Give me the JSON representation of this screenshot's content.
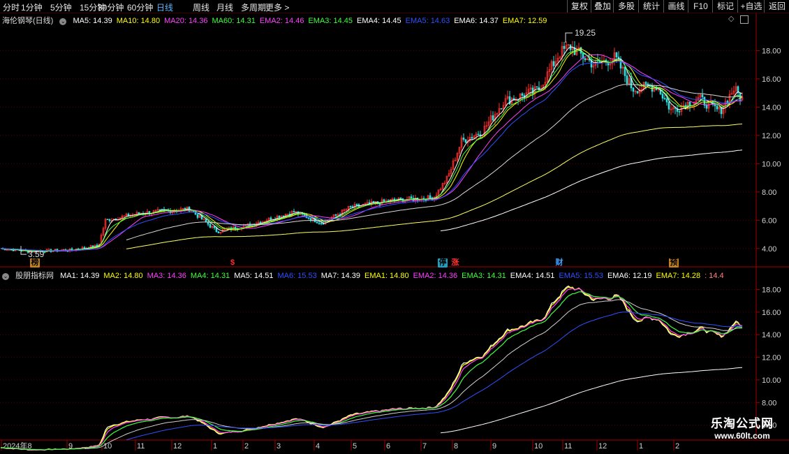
{
  "toolbar": {
    "periods": [
      "分时",
      "1分钟",
      "5分钟",
      "15分钟",
      "30分钟",
      "60分钟",
      "日线",
      "周线",
      "月线",
      "多周期",
      "更多 >"
    ],
    "active_index": 6,
    "right_buttons": [
      "复权",
      "叠加",
      "多股",
      "统计",
      "画线",
      "F10",
      "标记",
      "+自选",
      "返回"
    ]
  },
  "main_panel": {
    "title": "海伦钢琴(日线)",
    "indicators": [
      {
        "label": "MA5: 14.39",
        "color": "#ffffff"
      },
      {
        "label": "MA10: 14.80",
        "color": "#ffff00"
      },
      {
        "label": "MA20: 14.36",
        "color": "#ff40ff"
      },
      {
        "label": "MA60: 14.31",
        "color": "#40ff40"
      },
      {
        "label": "EMA2: 14.46",
        "color": "#ff40ff"
      },
      {
        "label": "EMA3: 14.45",
        "color": "#40ff40"
      },
      {
        "label": "EMA4: 14.45",
        "color": "#ffffff"
      },
      {
        "label": "EMA5: 14.63",
        "color": "#3050ff"
      },
      {
        "label": "EMA6: 14.37",
        "color": "#ffffff"
      },
      {
        "label": "EMA7: 12.59",
        "color": "#ffff00"
      }
    ],
    "y_ticks": [
      "18.00",
      "16.00",
      "14.00",
      "12.00",
      "10.00",
      "8.00",
      "6.00",
      "4.00"
    ],
    "high_label": "19.25",
    "low_label": "3.59",
    "markers": [
      {
        "text": "榜",
        "bg": "#c08020",
        "fg": "#000"
      },
      {
        "text": "$",
        "bg": "transparent",
        "fg": "#ff3030"
      },
      {
        "text": "停",
        "bg": "#20a0c0",
        "fg": "#000"
      },
      {
        "text": "涨",
        "bg": "transparent",
        "fg": "#ff3030"
      },
      {
        "text": "财",
        "bg": "transparent",
        "fg": "#40a0ff"
      },
      {
        "text": "预",
        "bg": "#c08020",
        "fg": "#000"
      }
    ]
  },
  "sub_panel": {
    "title": "股朋指标网",
    "indicators": [
      {
        "label": "MA1: 14.39",
        "color": "#ffffff"
      },
      {
        "label": "MA2: 14.80",
        "color": "#ffff00"
      },
      {
        "label": "MA3: 14.36",
        "color": "#ff40ff"
      },
      {
        "label": "MA4: 14.31",
        "color": "#40ff40"
      },
      {
        "label": "MA5: 14.51",
        "color": "#ffffff"
      },
      {
        "label": "MA6: 15.53",
        "color": "#3050ff"
      },
      {
        "label": "MA7: 14.39",
        "color": "#ffffff"
      },
      {
        "label": "EMA1: 14.80",
        "color": "#ffff00"
      },
      {
        "label": "EMA2: 14.36",
        "color": "#ff40ff"
      },
      {
        "label": "EMA3: 14.31",
        "color": "#40ff40"
      },
      {
        "label": "EMA4: 14.51",
        "color": "#ffffff"
      },
      {
        "label": "EMA5: 15.53",
        "color": "#3050ff"
      },
      {
        "label": "EMA6: 12.19",
        "color": "#ffffff"
      },
      {
        "label": "EMA7: 14.28",
        "color": "#ffff00"
      },
      {
        "label": ": 14.4",
        "color": "#ff8080"
      }
    ],
    "y_ticks": [
      "18.00",
      "16.00",
      "14.00",
      "12.00",
      "10.00",
      "8.00",
      "6.00"
    ]
  },
  "x_axis": [
    "2024年8",
    "9",
    "10",
    "11",
    "12",
    "1",
    "2",
    "3",
    "4",
    "5",
    "6",
    "7",
    "8",
    "9",
    "10",
    "11",
    "12",
    "1",
    "2"
  ],
  "colors": {
    "up": "#ff3030",
    "down": "#30e0e0",
    "grid": "#5a0000",
    "axis": "#a00000",
    "tick_text": "#d0d0d0"
  },
  "watermark": {
    "line1": "乐淘公式网",
    "line2": "www.60lt.com"
  }
}
